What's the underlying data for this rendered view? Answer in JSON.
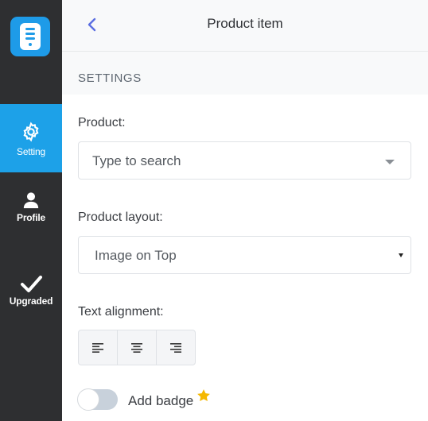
{
  "sidebar": {
    "items": [
      {
        "label": "Setting",
        "icon": "gear-icon",
        "active": true
      },
      {
        "label": "Profile",
        "icon": "user-icon",
        "active": false
      },
      {
        "label": "Upgraded",
        "icon": "checkmark-icon",
        "active": false
      }
    ]
  },
  "header": {
    "title": "Product item"
  },
  "section": {
    "title": "SETTINGS"
  },
  "product": {
    "label": "Product:",
    "placeholder": "Type to search"
  },
  "layout": {
    "label": "Product layout:",
    "value": "Image on Top"
  },
  "alignment": {
    "label": "Text alignment:",
    "options": [
      "left",
      "center",
      "right"
    ]
  },
  "badge": {
    "label": "Add badge",
    "enabled": false
  },
  "colors": {
    "accent": "#1da1e8",
    "sidebar": "#2e2f31",
    "star": "#f5b800",
    "back_arrow": "#5b6ee1"
  }
}
